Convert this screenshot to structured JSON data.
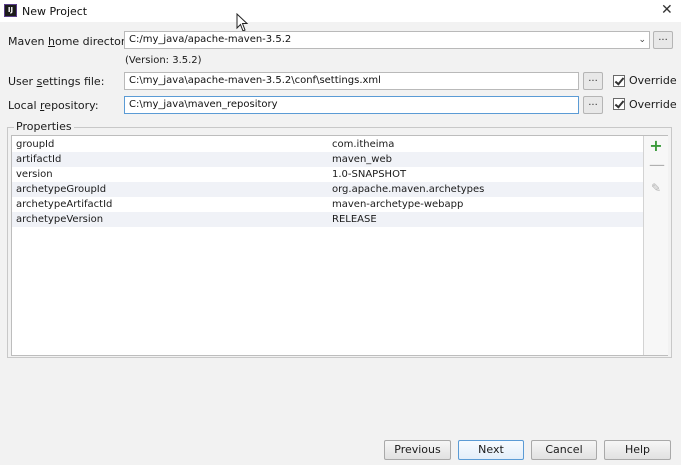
{
  "window": {
    "title": "New Project",
    "icon_text": "IJ"
  },
  "form": {
    "maven_home": {
      "label_pre": "Maven ",
      "label_mnemonic": "h",
      "label_post": "ome directory:",
      "value": "C:/my_java/apache-maven-3.5.2",
      "version_text": "(Version: 3.5.2)"
    },
    "user_settings": {
      "label_pre": "User ",
      "label_mnemonic": "s",
      "label_post": "ettings file:",
      "value": "C:\\my_java\\apache-maven-3.5.2\\conf\\settings.xml",
      "override_label": "Override",
      "override_checked": true
    },
    "local_repository": {
      "label_pre": "Local ",
      "label_mnemonic": "r",
      "label_post": "epository:",
      "value": "C:\\my_java\\maven_repository",
      "override_label": "Override",
      "override_checked": true
    },
    "browse_label": "..."
  },
  "properties": {
    "title": "Properties",
    "rows": [
      {
        "key": "groupId",
        "value": "com.itheima"
      },
      {
        "key": "artifactId",
        "value": "maven_web"
      },
      {
        "key": "version",
        "value": "1.0-SNAPSHOT"
      },
      {
        "key": "archetypeGroupId",
        "value": "org.apache.maven.archetypes"
      },
      {
        "key": "archetypeArtifactId",
        "value": "maven-archetype-webapp"
      },
      {
        "key": "archetypeVersion",
        "value": "RELEASE"
      }
    ],
    "toolbar": {
      "add": "+",
      "remove": "—",
      "edit": "✎"
    }
  },
  "buttons": {
    "previous": "Previous",
    "next": "Next",
    "cancel": "Cancel",
    "help": "Help"
  },
  "colors": {
    "focus_border": "#5b9bd5",
    "add_icon": "#3a9a3a",
    "alt_row": "#f0f2f7"
  }
}
